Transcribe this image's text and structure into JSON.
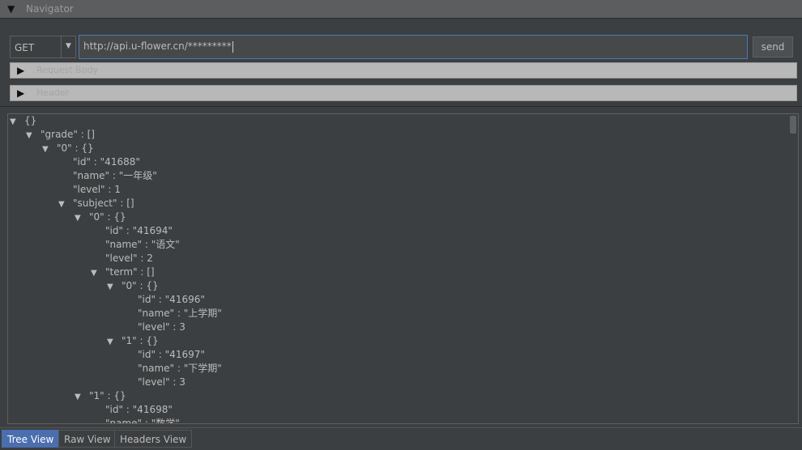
{
  "window": {
    "title": "Navigator"
  },
  "request": {
    "method": "GET",
    "url": "http://api.u-flower.cn/*********",
    "send_label": "send"
  },
  "sections": [
    {
      "label": "Request Body"
    },
    {
      "label": "Header"
    }
  ],
  "tree": {
    "rows": [
      {
        "text": "{}"
      },
      {
        "text": "\"grade\" : []"
      },
      {
        "text": "\"0\" : {}"
      },
      {
        "text": "\"id\" : \"41688\""
      },
      {
        "text": "\"name\" : \"一年级\""
      },
      {
        "text": "\"level\" : 1"
      },
      {
        "text": "\"subject\" : []"
      },
      {
        "text": "\"0\" : {}"
      },
      {
        "text": "\"id\" : \"41694\""
      },
      {
        "text": "\"name\" : \"语文\""
      },
      {
        "text": "\"level\" : 2"
      },
      {
        "text": "\"term\" : []"
      },
      {
        "text": "\"0\" : {}"
      },
      {
        "text": "\"id\" : \"41696\""
      },
      {
        "text": "\"name\" : \"上学期\""
      },
      {
        "text": "\"level\" : 3"
      },
      {
        "text": "\"1\" : {}"
      },
      {
        "text": "\"id\" : \"41697\""
      },
      {
        "text": "\"name\" : \"下学期\""
      },
      {
        "text": "\"level\" : 3"
      },
      {
        "text": "\"1\" : {}"
      },
      {
        "text": "\"id\" : \"41698\""
      },
      {
        "text": "\"name\" : \"数学\""
      }
    ]
  },
  "tabs": [
    {
      "label": "Tree View",
      "active": true
    },
    {
      "label": "Raw View",
      "active": false
    },
    {
      "label": "Headers View",
      "active": false
    }
  ]
}
